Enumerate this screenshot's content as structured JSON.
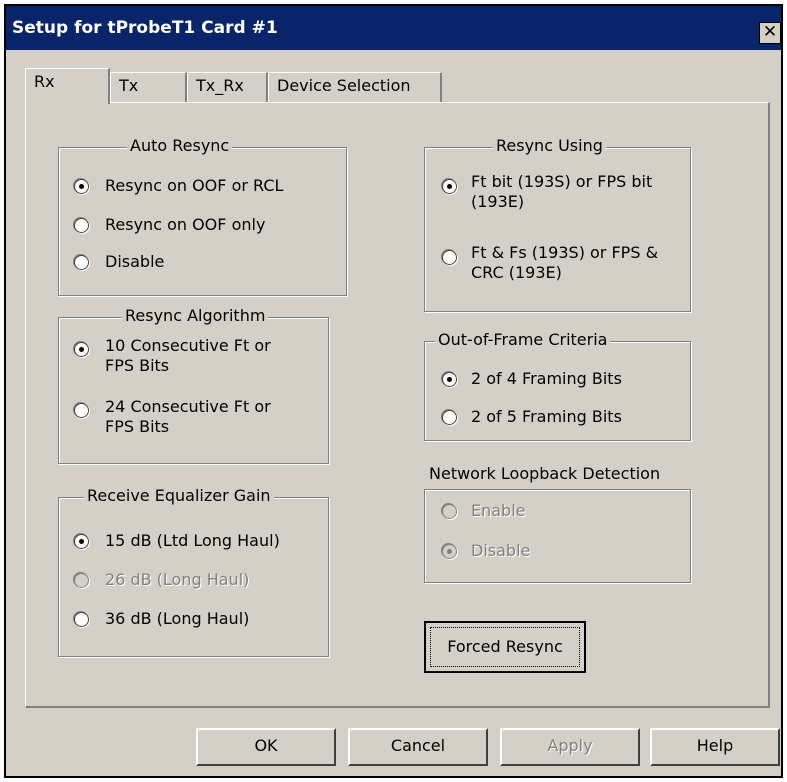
{
  "window": {
    "title": "Setup for tProbeT1 Card #1",
    "close_glyph": "✕"
  },
  "tabs": [
    {
      "label": "Rx",
      "active": true
    },
    {
      "label": "Tx",
      "active": false
    },
    {
      "label": "Tx_Rx",
      "active": false
    },
    {
      "label": "Device Selection",
      "active": false
    }
  ],
  "auto_resync": {
    "title": "Auto Resync",
    "options": [
      "Resync on OOF or RCL",
      "Resync on OOF only",
      "Disable"
    ],
    "selected": 0
  },
  "resync_algorithm": {
    "title": "Resync Algorithm",
    "options": [
      {
        "line1": "10 Consecutive Ft or",
        "line2": "FPS Bits"
      },
      {
        "line1": "24 Consecutive Ft or",
        "line2": "FPS Bits"
      }
    ],
    "selected": 0
  },
  "receive_equalizer_gain": {
    "title": "Receive Equalizer Gain",
    "options": [
      "15 dB (Ltd Long Haul)",
      "26 dB (Long Haul)",
      "36 dB (Long Haul)"
    ],
    "selected": 0,
    "disabled_option": 1
  },
  "resync_using": {
    "title": "Resync Using",
    "options": [
      {
        "line1": "Ft bit (193S) or FPS bit",
        "line2": "(193E)"
      },
      {
        "line1": "Ft & Fs (193S) or FPS &",
        "line2": "CRC (193E)"
      }
    ],
    "selected": 0
  },
  "out_of_frame": {
    "title": "Out-of-Frame Criteria",
    "options": [
      "2 of 4 Framing Bits",
      "2 of 5 Framing Bits"
    ],
    "selected": 0
  },
  "network_loopback": {
    "title": "Network Loopback Detection",
    "options": [
      "Enable",
      "Disable"
    ],
    "selected": 1,
    "disabled": true
  },
  "forced_resync_label": "Forced Resync",
  "buttons": {
    "ok": "OK",
    "cancel": "Cancel",
    "apply": "Apply",
    "help": "Help"
  },
  "colors": {
    "titlebar": "#0a246a",
    "face": "#d4d0c8",
    "disabled_text": "#808080"
  }
}
